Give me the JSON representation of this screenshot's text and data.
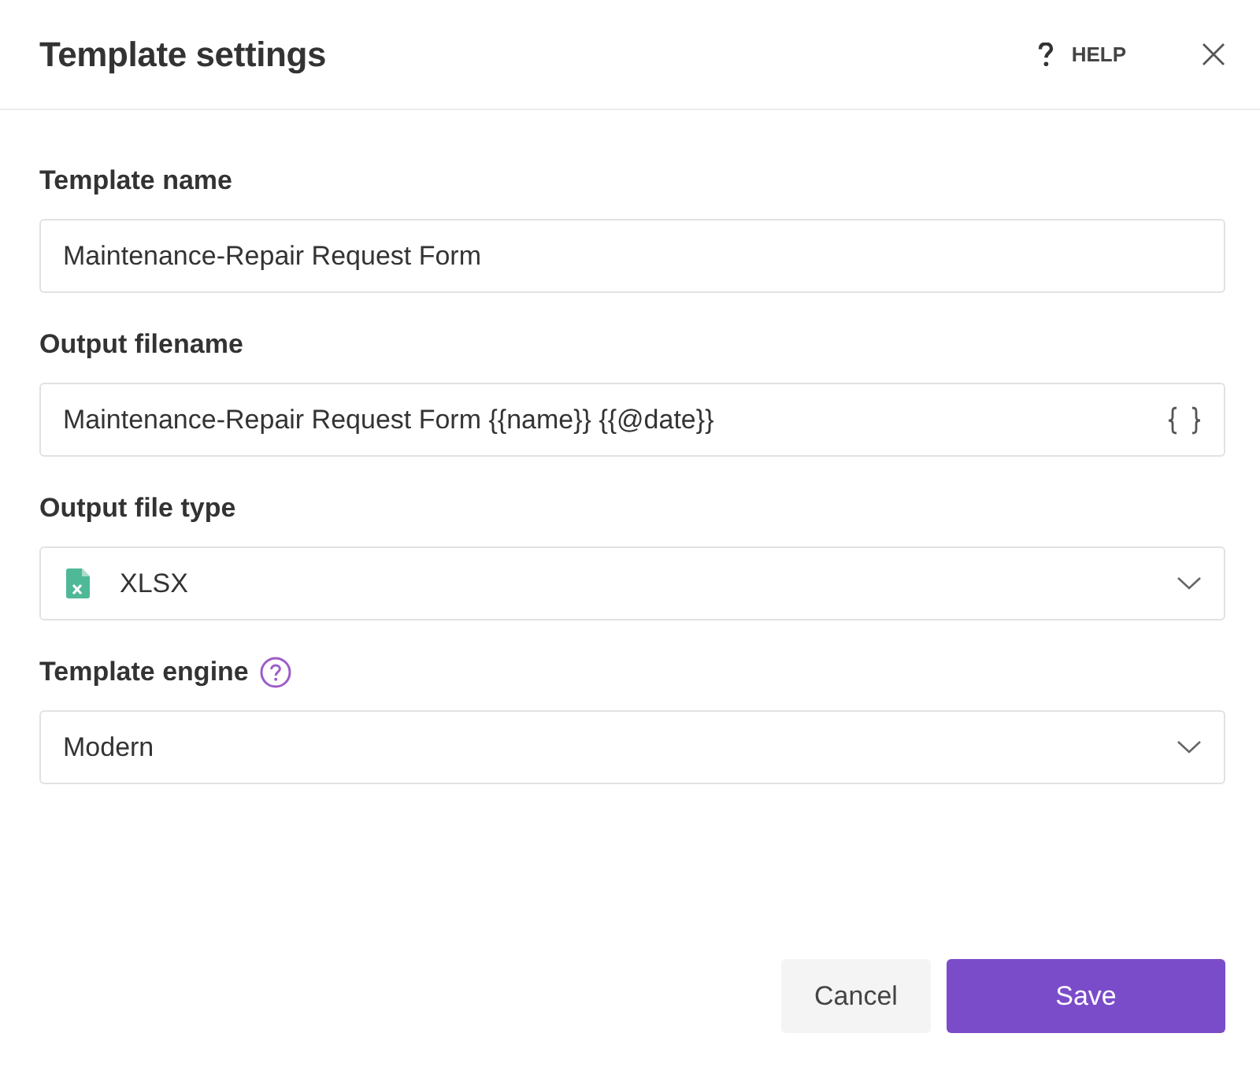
{
  "dialog": {
    "title": "Template settings",
    "help_label": "HELP"
  },
  "fields": [
    {
      "kind": "text",
      "label": "Template name",
      "help": false,
      "value": "Maintenance-Repair Request Form"
    },
    {
      "kind": "variables",
      "label": "Output filename",
      "help": false,
      "value": "Maintenance-Repair Request Form {{name}} {{@date}}"
    },
    {
      "kind": "file-select",
      "label": "Output file type",
      "help": false,
      "value": "XLSX"
    },
    {
      "kind": "select",
      "label": "Template engine",
      "help": true,
      "value": "Modern"
    }
  ],
  "buttons": [
    {
      "kind": "secondary",
      "label": "Cancel"
    },
    {
      "kind": "primary",
      "label": "Save"
    }
  ]
}
